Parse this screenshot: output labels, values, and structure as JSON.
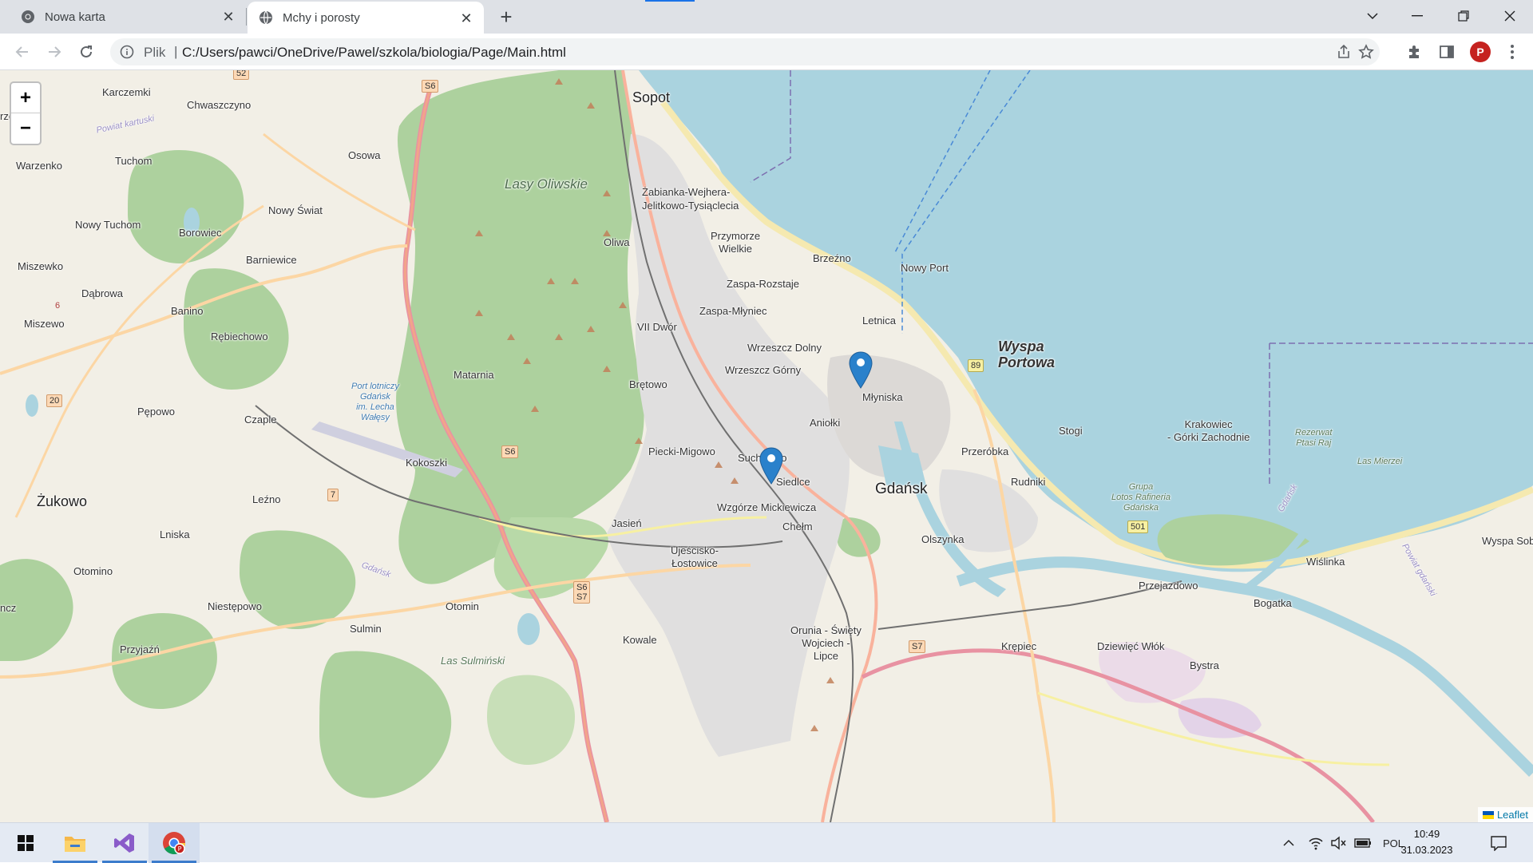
{
  "browser": {
    "tabs": [
      {
        "title": "Nowa karta",
        "icon": "chrome-icon",
        "active": false
      },
      {
        "title": "Mchy i porosty",
        "icon": "globe-icon",
        "active": true
      }
    ],
    "new_tab_symbol": "+",
    "address": {
      "scheme_label": "Plik",
      "separator": "|",
      "url": "C:/Users/pawci/OneDrive/Pawel/szkola/biologia/Page/Main.html"
    },
    "profile_initial": "P"
  },
  "map": {
    "zoom_in": "+",
    "zoom_out": "−",
    "attribution": "Leaflet",
    "places": {
      "sopot": "Sopot",
      "gdansk": "Gdańsk",
      "lasy_oliwskie": "Lasy Oliwskie",
      "wyspa_portowa": "Wyspa\nPortowa",
      "karczemki": "Karczemki",
      "chwaszczyno": "Chwaszczyno",
      "osowa": "Osowa",
      "warzenko": "Warzenko",
      "tuchom": "Tuchom",
      "nowy_swiat": "Nowy Świat",
      "nowy_tuchom": "Nowy Tuchom",
      "borowiec": "Borowiec",
      "miszewko": "Miszewko",
      "barniewice": "Barniewice",
      "dabrowa": "Dąbrowa",
      "banino": "Banino",
      "miszewo": "Miszewo",
      "rebiechowo": "Rębiechowo",
      "matarnia": "Matarnia",
      "pepowo": "Pępowo",
      "czaple": "Czaple",
      "zukowo": "Żukowo",
      "lezno": "Leźno",
      "kokoszki": "Kokoszki",
      "lniska": "Lniska",
      "otomino": "Otomino",
      "niestepowo": "Niestępowo",
      "otomin": "Otomin",
      "sulmin": "Sulmin",
      "przyjazn": "Przyjaźń",
      "las_sulminski": "Las Sulmiński",
      "oliwa": "Oliwa",
      "zabianka": "Żabianka-Wejhera-\nJelitkowo-Tysiąclecia",
      "przymorze": "Przymorze\nWielkie",
      "zaspa_rozstaje": "Zaspa-Rozstaje",
      "zaspa_mlyniec": "Zaspa-Młyniec",
      "vii_dwor": "VII Dwór",
      "wrzeszcz_dolny": "Wrzeszcz Dolny",
      "wrzeszcz_gorny": "Wrzeszcz Górny",
      "bretowo": "Brętowo",
      "brzezno": "Brzeźno",
      "nowy_port": "Nowy Port",
      "letnica": "Letnica",
      "mlyniska": "Młyniska",
      "aniolki": "Aniołki",
      "piecki": "Piecki-Migowo",
      "suchanino": "Suchanino",
      "siedlce": "Siedlce",
      "wzgorze": "Wzgórze Mickiewicza",
      "jasien": "Jasień",
      "chelm": "Chełm",
      "ujescisko": "Ujeścisko-\nŁostowice",
      "orunia": "Orunia - Święty\nWojciech -\nLipce",
      "kowale": "Kowale",
      "przerobka": "Przeróbka",
      "rudniki": "Rudniki",
      "olszynka": "Olszynka",
      "stogi": "Stogi",
      "krakowiec": "Krakowiec\n- Górki Zachodnie",
      "rezerwat": "Rezerwat\nPtasi Raj",
      "las_mierzei": "Las Mierzei",
      "grupa_lotos": "Grupa\nLotos Rafineria\nGdańska",
      "przejazdowo": "Przejazdowo",
      "bogatka": "Bogatka",
      "wislinka": "Wiślinka",
      "krepiec": "Krępiec",
      "dziewiec_wlok": "Dziewięć Włók",
      "bystra": "Bystra",
      "wyspa_sob": "Wyspa Sob",
      "port_lotniczy": "Port lotniczy\nGdańsk\nim. Lecha\nWałęsy",
      "powiat_kartuski": "Powiat kartuski",
      "gdansk_small": "Gdańsk",
      "ncz": "ncz",
      "rzo": "rzo",
      "powiat_gdanski": "Powiat gdański",
      "gdansk_river": "Gdańsk"
    },
    "shields": {
      "s6_top": "S6",
      "s6_mid": "S6",
      "s6s7": "S6\nS7",
      "s7": "S7",
      "r89": "89",
      "r501": "501",
      "r52": "52",
      "r20": "20",
      "r7": "7",
      "r6": "6"
    },
    "markers": [
      {
        "name": "Letnica marker",
        "color": "#2a81cb"
      },
      {
        "name": "Wrzeszcz Górny marker",
        "color": "#2a81cb"
      }
    ]
  },
  "taskbar": {
    "apps": [
      "start-icon",
      "file-explorer-icon",
      "visual-studio-icon",
      "chrome-icon"
    ],
    "language": "POL",
    "time": "10:49",
    "date": "31.03.2023"
  }
}
